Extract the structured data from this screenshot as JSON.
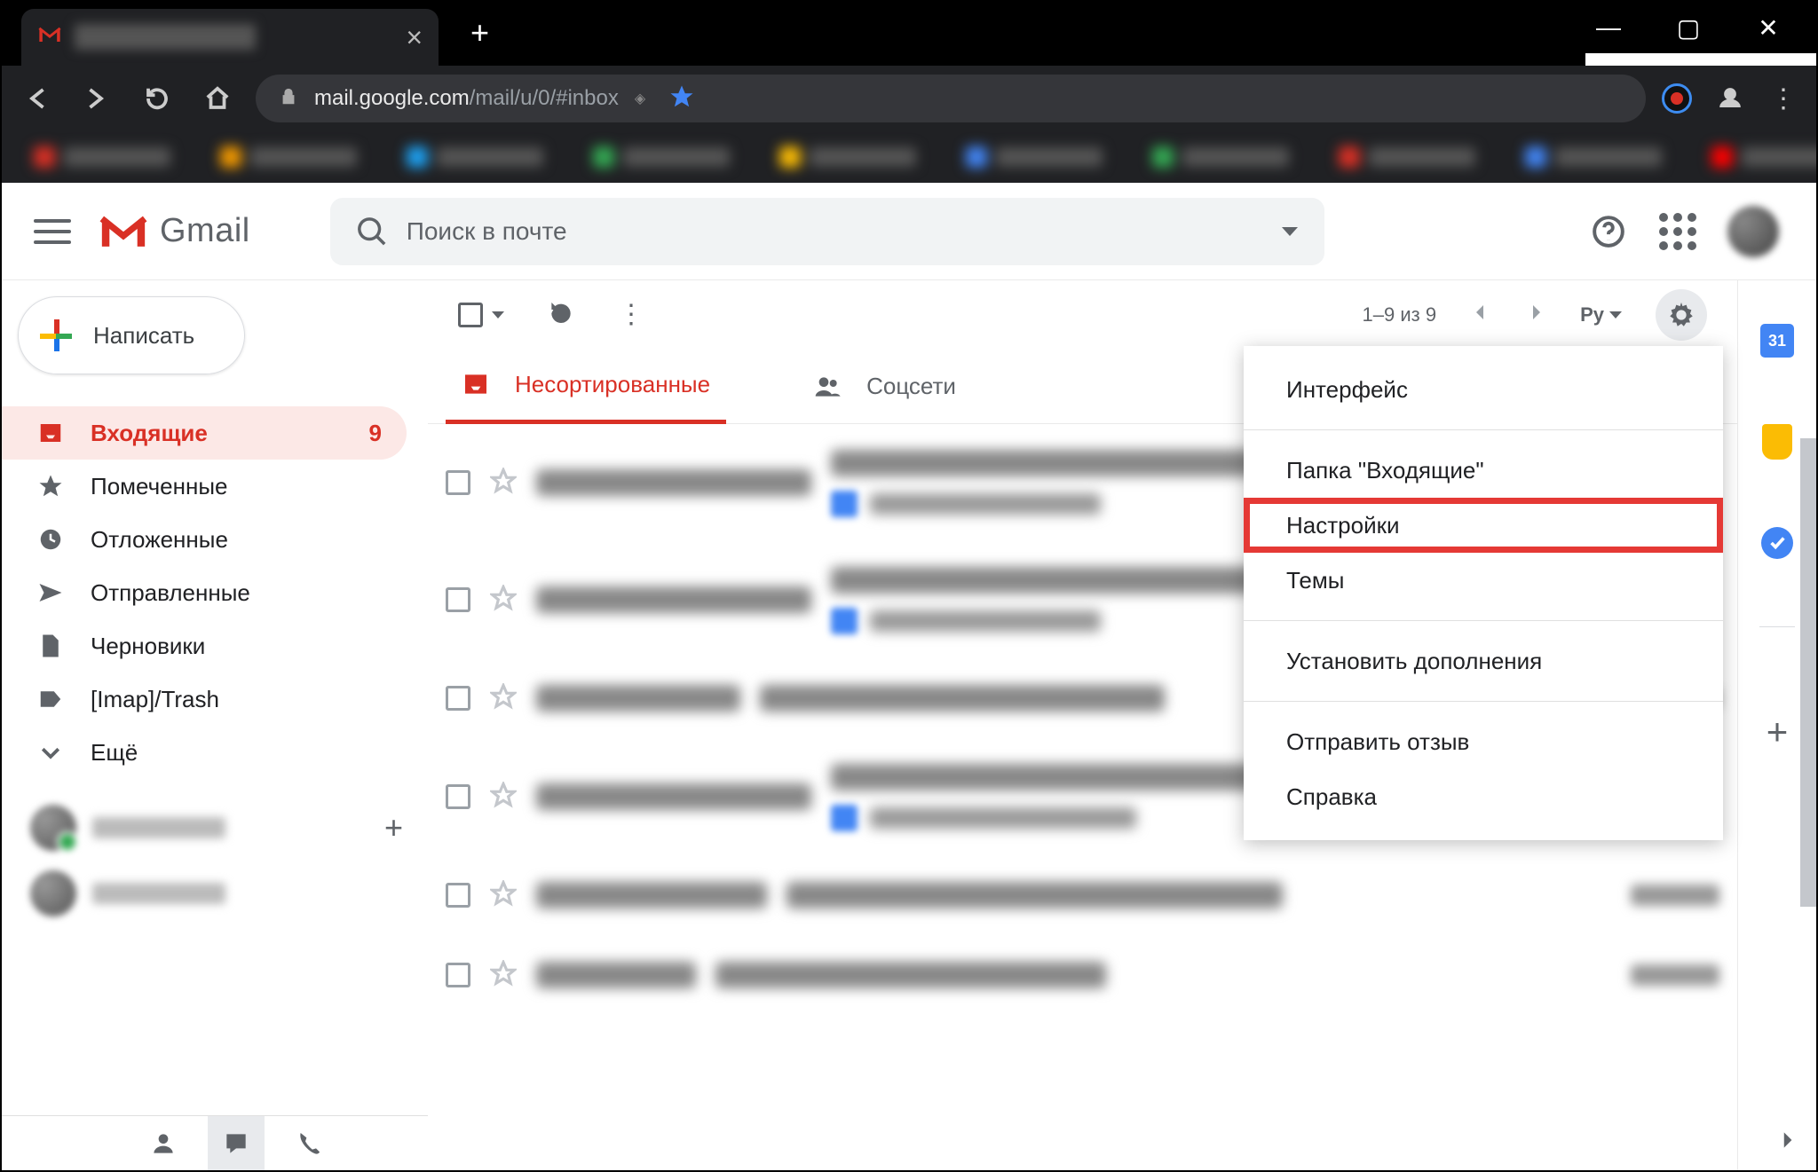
{
  "browser": {
    "url_host": "mail.google.com",
    "url_path": "/mail/u/0/#inbox"
  },
  "app_name": "Gmail",
  "search": {
    "placeholder": "Поиск в почте"
  },
  "compose_label": "Написать",
  "sidebar": {
    "items": [
      {
        "label": "Входящие",
        "count": "9",
        "icon": "inbox"
      },
      {
        "label": "Помеченные",
        "icon": "star"
      },
      {
        "label": "Отложенные",
        "icon": "clock"
      },
      {
        "label": "Отправленные",
        "icon": "send"
      },
      {
        "label": "Черновики",
        "icon": "file"
      },
      {
        "label": "[Imap]/Trash",
        "icon": "label"
      },
      {
        "label": "Ещё",
        "icon": "chevron-down"
      }
    ]
  },
  "toolbar": {
    "pager_text": "1–9 из 9",
    "lang": "Py"
  },
  "tabs": [
    {
      "label": "Несортированные",
      "active": true
    },
    {
      "label": "Соцсети",
      "active": false
    }
  ],
  "settings_menu": {
    "items": [
      {
        "label": "Интерфейс"
      },
      {
        "label": "Папка \"Входящие\""
      },
      {
        "label": "Настройки",
        "highlight": true
      },
      {
        "label": "Темы"
      },
      {
        "label": "Установить дополнения"
      },
      {
        "label": "Отправить отзыв"
      },
      {
        "label": "Справка"
      }
    ]
  },
  "sidepanel": {
    "calendar_day": "31"
  }
}
